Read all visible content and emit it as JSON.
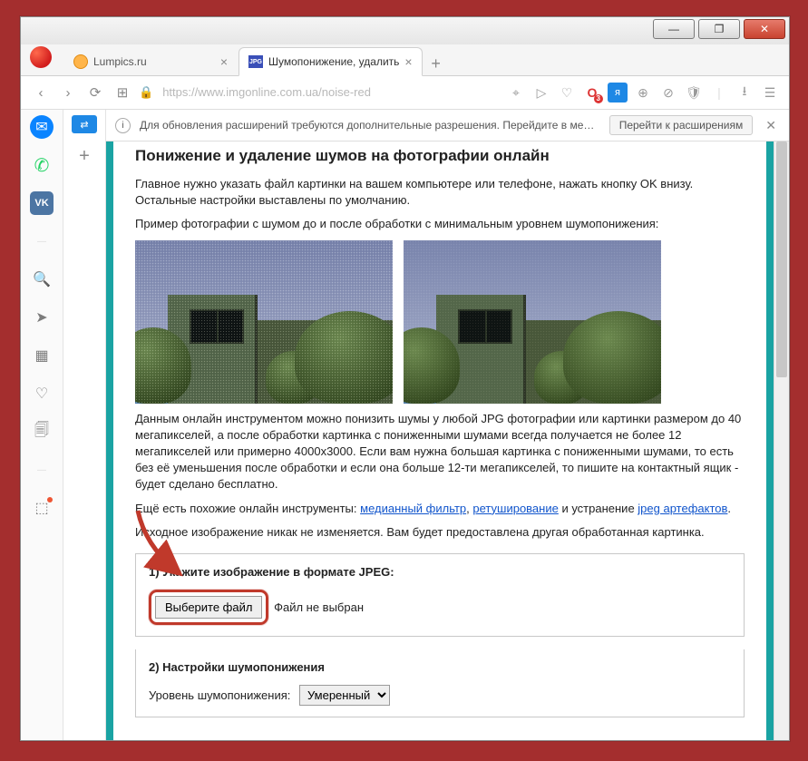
{
  "window_controls": {
    "minimize": "—",
    "maximize": "❐",
    "close": "✕"
  },
  "tabs": {
    "items": [
      {
        "title": "Lumpics.ru",
        "favicon": "lump"
      },
      {
        "title": "Шумопонижение, удалить",
        "favicon": "jpg"
      }
    ],
    "new": "+"
  },
  "addressbar": {
    "back": "‹",
    "forward": "›",
    "reload": "⟳",
    "speed": "⊞",
    "lock": "🔒",
    "url": "https://www.imgonline.com.ua/noise-red",
    "icons": {
      "camera": "⌖",
      "play": "▷",
      "heart": "♡",
      "o": "O",
      "t": "я",
      "globe": "⊕",
      "ad": "⊘",
      "shield": "🛡",
      "sep": "|",
      "dl": "⭳",
      "menu": "☰"
    },
    "o_badge": "3"
  },
  "leftstrip": {
    "fb": "✉",
    "wa": "✆",
    "vk": "VK",
    "sep": "—",
    "search": "🔍",
    "send": "➤",
    "grid": "▦",
    "heart": "♡",
    "clip": "🗐",
    "sep2": "—",
    "cube": "⬚"
  },
  "midstrip": {
    "translate": "⇄",
    "plus": "+"
  },
  "infobar": {
    "icon": "i",
    "msg": "Для обновления расширений требуются дополнительные разрешения. Перейдите в ме…",
    "button": "Перейти к расширениям",
    "close": "✕"
  },
  "page": {
    "h2": "Понижение и удаление шумов на фотографии онлайн",
    "p1": "Главное нужно указать файл картинки на вашем компьютере или телефоне, нажать кнопку OK внизу. Остальные настройки выставлены по умолчанию.",
    "p2": "Пример фотографии с шумом до и после обработки с минимальным уровнем шумопонижения:",
    "p3": "Данным онлайн инструментом можно понизить шумы у любой JPG фотографии или картинки размером до 40 мегапикселей, а после обработки картинка с пониженными шумами всегда получается не более 12 мегапикселей или примерно 4000x3000. Если вам нужна большая картинка с пониженными шумами, то есть без её уменьшения после обработки и если она больше 12-ти мегапикселей, то пишите на контактный ящик - будет сделано бесплатно.",
    "p4_a": "Ещё есть похожие онлайн инструменты: ",
    "p4_l1": "медианный фильтр",
    "p4_s1": ", ",
    "p4_l2": "ретуширование",
    "p4_s2": " и устранение ",
    "p4_l3": "jpeg артефактов",
    "p4_d": ".",
    "p5": "Исходное изображение никак не изменяется. Вам будет предоставлена другая обработанная картинка.",
    "step1": "1) Укажите изображение в формате JPEG:",
    "choose": "Выберите файл",
    "nofile": "Файл не выбран",
    "step2": "2) Настройки шумопонижения",
    "level_label": "Уровень шумопонижения: ",
    "level_value": "Умеренный"
  }
}
